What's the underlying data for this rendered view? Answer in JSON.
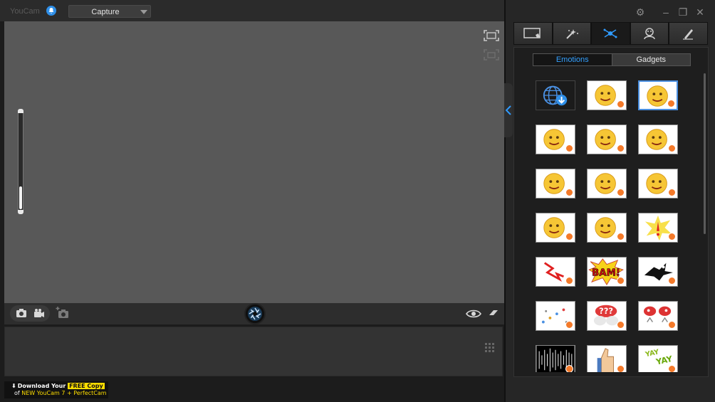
{
  "app": {
    "title": "YouCam",
    "mode_select": {
      "selected": "Capture"
    }
  },
  "ad": {
    "line1_prefix": "Download Your",
    "line1_highlight": "FREE Copy",
    "line2_prefix": "of",
    "line2_highlight": "NEW YouCam 7 + PerfectCam"
  },
  "zoom": {
    "level_fraction": 0.25
  },
  "panel": {
    "tabs": [
      {
        "icon": "frame-icon",
        "active": false
      },
      {
        "icon": "magic-wand-icon",
        "active": false
      },
      {
        "icon": "particle-effects-icon",
        "active": true
      },
      {
        "icon": "avatar-icon",
        "active": false
      },
      {
        "icon": "brush-icon",
        "active": false
      }
    ],
    "subtabs": [
      {
        "label": "Emotions",
        "active": true
      },
      {
        "label": "Gadgets",
        "active": false
      }
    ],
    "items": [
      {
        "icon": "download-more-icon",
        "kind": "download"
      },
      {
        "icon": "angry-face-icon",
        "kind": "emoji"
      },
      {
        "icon": "sleepy-face-icon",
        "kind": "emoji",
        "selected": true
      },
      {
        "icon": "bored-face-icon",
        "kind": "emoji"
      },
      {
        "icon": "laughing-face-icon",
        "kind": "emoji"
      },
      {
        "icon": "love-face-icon",
        "kind": "emoji"
      },
      {
        "icon": "scared-face-icon",
        "kind": "emoji"
      },
      {
        "icon": "confused-face-icon",
        "kind": "emoji"
      },
      {
        "icon": "nervous-face-icon",
        "kind": "emoji"
      },
      {
        "icon": "grinning-face-icon",
        "kind": "emoji"
      },
      {
        "icon": "wink-face-icon",
        "kind": "emoji"
      },
      {
        "icon": "exclamation-burst-icon",
        "kind": "burst"
      },
      {
        "icon": "lightning-icon",
        "kind": "zigzag"
      },
      {
        "icon": "bam-text-icon",
        "kind": "bam",
        "text": "BAM!"
      },
      {
        "icon": "crow-icon",
        "kind": "bird"
      },
      {
        "icon": "question-marks-icon",
        "kind": "dots"
      },
      {
        "icon": "question-bubbles-icon",
        "kind": "questions",
        "text": "???"
      },
      {
        "icon": "angry-bubbles-icon",
        "kind": "bubbles"
      },
      {
        "icon": "noise-bars-icon",
        "kind": "bars"
      },
      {
        "icon": "thumbs-up-icon",
        "kind": "thumb"
      },
      {
        "icon": "yay-text-icon",
        "kind": "yay",
        "text": "YAY"
      }
    ]
  },
  "colors": {
    "accent": "#2f8fe8",
    "badge": "#f47a2a",
    "ad_yellow": "#ffde00"
  }
}
